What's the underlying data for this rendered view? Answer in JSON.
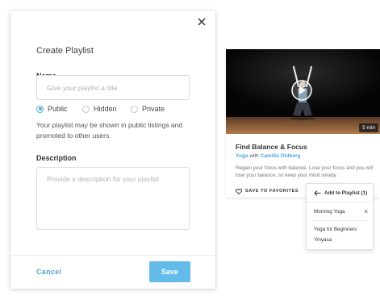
{
  "modal": {
    "title": "Create Playlist",
    "name_label": "Name",
    "name_placeholder": "Give your playlist a title",
    "name_value": "",
    "visibility": {
      "options": [
        {
          "label": "Public",
          "checked": true
        },
        {
          "label": "Hidden",
          "checked": false
        },
        {
          "label": "Private",
          "checked": false
        }
      ]
    },
    "visibility_help": "Your playlist may be shown in public listings and promoted to other users.",
    "description_label": "Description",
    "description_placeholder": "Provide a description for your playlist",
    "description_value": "",
    "cancel_label": "Cancel",
    "save_label": "Save"
  },
  "video": {
    "duration": "5 min",
    "title": "Find Balance & Focus",
    "category": "Yoga",
    "with_text": "with",
    "instructor": "Camilla Oldberg",
    "description": "Regain your focus with balance. Lose your focus and you will lose your balance, so keep your mind steady.",
    "favorite_label": "SAVE TO FAVORITES"
  },
  "popover": {
    "title": "Add to Playlist (1)",
    "selected": [
      {
        "label": "Morning Yoga"
      }
    ],
    "available": [
      {
        "label": "Yoga for Beginners"
      },
      {
        "label": "Yinyasa"
      }
    ]
  },
  "colors": {
    "accent": "#4fa7d9",
    "save_button": "#62bbe9"
  },
  "icons": {
    "close": "close-icon",
    "play": "play-icon",
    "heart": "heart-icon",
    "back_arrow": "arrow-left-icon",
    "remove": "close-icon"
  }
}
